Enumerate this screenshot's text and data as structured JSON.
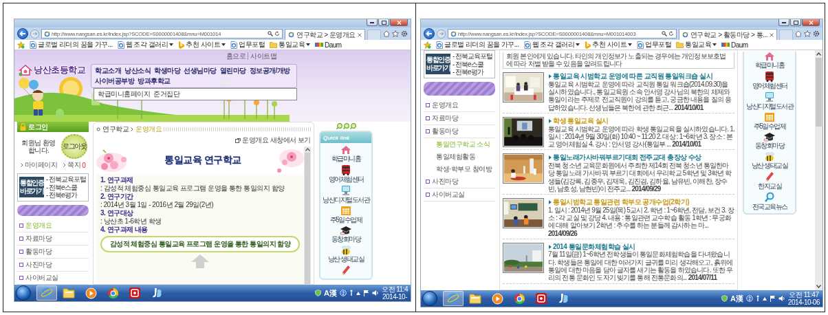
{
  "screens": [
    {
      "kind": "overview",
      "browser": {
        "url": "http://www.nangsan.es.kr/index.jsp?SCODE=S0000001408&mnu=M001014",
        "tab_title": "연구학교 > 운영개요",
        "favorites": [
          {
            "kind": "page",
            "label": "글로벌 리더의 꿈을 가꾸...",
            "dropdown": false
          },
          {
            "kind": "page",
            "label": "웹 조각 갤러리",
            "dropdown": true
          },
          {
            "kind": "bing",
            "label": "추천 사이트",
            "dropdown": true
          },
          {
            "kind": "page",
            "label": "업무포털",
            "dropdown": false
          },
          {
            "kind": "folder",
            "label": "통일교육",
            "dropdown": true
          },
          {
            "kind": "daum",
            "label": "Daum",
            "dropdown": false
          }
        ]
      },
      "page": {
        "top_links": [
          "홈으로",
          "사이트맵"
        ],
        "logo": "낭산초등학교",
        "nav": [
          "학교소개",
          "낭산소식",
          "학생마당",
          "선생님마당",
          "열린마당",
          "정보공개/개방",
          "사이버공부방",
          "방과후학교"
        ],
        "submenu": [
          "학급미니홈페이지",
          "준거집단"
        ],
        "login": {
          "title": "로그인",
          "greeting": "회원님 환영합니다.",
          "logout": "로그아웃",
          "links": [
            {
              "label": "마이페이지"
            },
            {
              "label": "쪽지",
              "count": "0"
            }
          ]
        },
        "auth": {
          "title": "통합인증 바로가기",
          "links": [
            "- 전북교육포털",
            "- 전북e스쿨",
            "- 전북e평가"
          ]
        },
        "menu": [
          {
            "label": "운영개요",
            "selected": true
          },
          {
            "label": "자료마당",
            "selected": false
          },
          {
            "label": "활동마당",
            "selected": false
          },
          {
            "label": "사진마당",
            "selected": false
          },
          {
            "label": "사이버교실",
            "selected": false
          }
        ],
        "breadcrumb": [
          "연구학교",
          "운영개요"
        ],
        "new_window": "운영개요 새창에서 보기",
        "title": "통일교육 연구학교",
        "sections": [
          {
            "heading": "1. 연구과제",
            "text": ": 감성적 체험중심 통일교육 프로그램 운영을 통한 통일의지 함양"
          },
          {
            "heading": "2. 연구기간",
            "text": ": 2014년 3월 1일 - 2016년 2월 29일(2년)"
          },
          {
            "heading": "3. 연구대상",
            "text": ": 낭산초 1-6학년 학생"
          },
          {
            "heading": "4. 연구과제 내용"
          }
        ],
        "highlight": "감성적 체험중심 통일교육 프로그램 운영을 통한 통일의지 함양",
        "quick_title": "Quick link",
        "quick_links": [
          {
            "kind": "house",
            "label": "학급미니홈"
          },
          {
            "kind": "bus",
            "label": "영어체험센터"
          },
          {
            "kind": "computer",
            "label": "낭산디지털도서관"
          },
          {
            "kind": "calendar",
            "label": "주5일수업제"
          },
          {
            "kind": "graduation",
            "label": "동창회마당"
          },
          {
            "kind": "bee",
            "label": "낭산 생태교실"
          },
          {
            "kind": "pencil"
          }
        ]
      },
      "taskbar": {
        "apps": [
          {
            "kind": "ie",
            "selected": true
          },
          {
            "kind": "folder",
            "selected": false
          },
          {
            "kind": "media",
            "selected": false
          },
          {
            "kind": "chrome",
            "selected": false
          },
          {
            "kind": "hangul",
            "selected": false
          },
          {
            "kind": "jb",
            "selected": false
          }
        ],
        "ime": "A漢",
        "time": "오전 11:4",
        "date": "2014-10-"
      }
    },
    {
      "kind": "news",
      "browser": {
        "url": "http://www.nangsan.es.kr/index.jsp?SCODE=S0000001408&mnu=M001014003",
        "tab_title": "연구학교 > 활동마당 > 통...",
        "favorites": [
          {
            "kind": "page",
            "label": "글로벌 리더의 꿈을 가꾸...",
            "dropdown": false
          },
          {
            "kind": "page",
            "label": "웹 조각 갤러리",
            "dropdown": true
          },
          {
            "kind": "bing",
            "label": "추천 사이트",
            "dropdown": true
          },
          {
            "kind": "page",
            "label": "업무포털",
            "dropdown": false
          },
          {
            "kind": "folder",
            "label": "통일교육",
            "dropdown": true
          },
          {
            "kind": "daum",
            "label": "Daum",
            "dropdown": false
          }
        ]
      },
      "page": {
        "auth": {
          "title": "통합인증 바로가기",
          "links": [
            "- 전북교육포털",
            "- 전북e스쿨",
            "- 전북e평가"
          ]
        },
        "menu": [
          {
            "label": "운영개요",
            "selected": false
          },
          {
            "label": "자료마당",
            "selected": false
          },
          {
            "label": "활동마당",
            "selected": false,
            "children": [
              {
                "label": "통일연구학교 소식",
                "selected": true
              },
              {
                "label": "통일체험활동",
                "selected": false
              },
              {
                "label": "학생·학부모 참여방",
                "selected": false
              }
            ]
          },
          {
            "label": "사진마당",
            "selected": false
          },
          {
            "label": "사이버교실",
            "selected": false
          }
        ],
        "notice": "회원 본인에게 있습니다. 타인의 개인정보가 노출되는 경우에는 개인정보보호법에 따라 처벌 받을 수 있음을 알려드립니다",
        "news": [
          {
            "title": "통일교육 시범학교 운영에 따른 교직원 통일워크숍 실시",
            "color": "#1d7a8c",
            "body": "통일교육 시범학교 운영에 따라 교직원 통일 워크숍(2014.09.30)을 실시하였습니다., 통일교육원 소속 안서영 강사님의 북한의 체제와 통일이라는 주제로 전교직원이 강의를 듣고, 궁금한 내용을 질의 응답하였습니다. 선생님들은 북한에 관한 최근... **2014/10/01**"
          },
          {
            "title": "학생 통일교육 실시",
            "color": "#c89a1a",
            "body": "통일교육 시범학교 운영에 따라 학생 통일교육을 실시하였습니다. 1. 일시 : 2014년 9월 30일(화) 10:40 ~ 11:20 2. 대상 : 1~6학년 3. 장소 : 본교 영어체험실 4. 강사 : 안서영 강사(통일부 ... **2014/10/01**"
          },
          {
            "title": "통일노래가사바꿔부르기대회 전주교대 총장상 수상",
            "color": "#1d7a8c",
            "body": "전북 청소년 교육문화원에서 주최한 제14회 전북 청소년 통일한마당 통일노래 가사바꿔 부르기 대회에서 우리학교 5학년 및 3학년 학생들(김강록, 김종우, 김재욱, 김진겸, 김하율, 남유빈, 이해찬, 장수빈, 남호성, 남현빈)이 전주교... **2014/09/29**"
          },
          {
            "title": "통일시범학교 통일관련 학부모 공개수업(2학기)",
            "color": "#c89a1a",
            "body": "1. 일시 : 2014년 9월 25일(목) 5교시 2. 학년 : 1~6학년, 전담, 보건 3. 장소 : 각 교실 및 강당 4. 내용 : 통일관련 교수학습 활동 1학년 : 무궁화에 대해 알아보기 2학년 : 추수를 하는 분들께 감사하는 마... **2014/09/26**"
          },
          {
            "title": "2014 통일문화체험학습 실시",
            "color": "#1d7a8c",
            "body": "7월 11일(금) 1~6학년 전학생들이 통일문화체험학습을 다녀왔습니다. 학생들은 통일에 대한 여러가지 글귀를 미리 생각해오고, 흙위에 통일에 대한 마음을 담아 글자를 새기는 활동을 하였습니다. 또한 우리의 전통 문화인 도자기 빚기를 통해 전통문화의... **2014/07/11**"
          }
        ],
        "quick_links": [
          {
            "kind": "house",
            "label": "학급미니홈"
          },
          {
            "kind": "bus",
            "label": "영어체험센터"
          },
          {
            "kind": "computer",
            "label": "낭산디지털도서관"
          },
          {
            "kind": "calendar",
            "label": "주5일수업제"
          },
          {
            "kind": "graduation",
            "label": "동창회마당"
          },
          {
            "kind": "bee",
            "label": "낭산 생태교실"
          },
          {
            "kind": "pencil",
            "label": "한자교실"
          },
          {
            "kind": "magnifier",
            "label": "전국교육뉴스"
          }
        ]
      },
      "taskbar": {
        "apps": [
          {
            "kind": "ie",
            "selected": true
          },
          {
            "kind": "folder",
            "selected": false
          },
          {
            "kind": "media",
            "selected": false
          },
          {
            "kind": "chrome",
            "selected": false
          },
          {
            "kind": "hangul",
            "selected": false
          },
          {
            "kind": "jb",
            "selected": false
          }
        ],
        "ime": "A漢",
        "time": "오전 11:47",
        "date": "2014-10-06"
      }
    }
  ]
}
